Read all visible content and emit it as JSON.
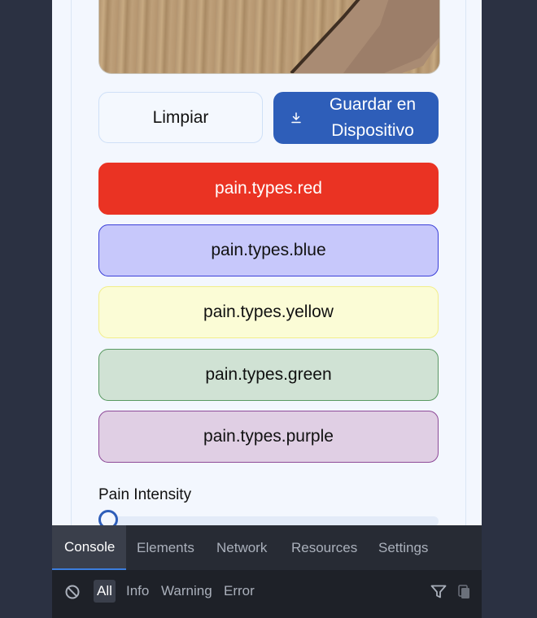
{
  "actions": {
    "clear_label": "Limpiar",
    "save_label": "Guardar en Dispositivo"
  },
  "pain_types": [
    {
      "label": "pain.types.red",
      "bg": "#ea3323",
      "border": "#ea3323",
      "text": "#ffffff"
    },
    {
      "label": "pain.types.blue",
      "bg": "#c7c8fb",
      "border": "#3b3fd8",
      "text": "#111111"
    },
    {
      "label": "pain.types.yellow",
      "bg": "#fbfcd6",
      "border": "#f2ee8a",
      "text": "#111111"
    },
    {
      "label": "pain.types.green",
      "bg": "#d0e2d4",
      "border": "#5a9a62",
      "text": "#111111"
    },
    {
      "label": "pain.types.purple",
      "bg": "#e0cfe4",
      "border": "#8e4a98",
      "text": "#111111"
    }
  ],
  "intensity": {
    "label": "Pain Intensity",
    "value_fraction": 0.0
  },
  "devtools": {
    "tabs": [
      "Console",
      "Elements",
      "Network",
      "Resources",
      "Settings"
    ],
    "active_tab": "Console",
    "filters": [
      "All",
      "Info",
      "Warning",
      "Error"
    ],
    "active_filter": "All"
  },
  "colors": {
    "accent": "#2e5eb9",
    "page_bg": "#2b3142"
  }
}
